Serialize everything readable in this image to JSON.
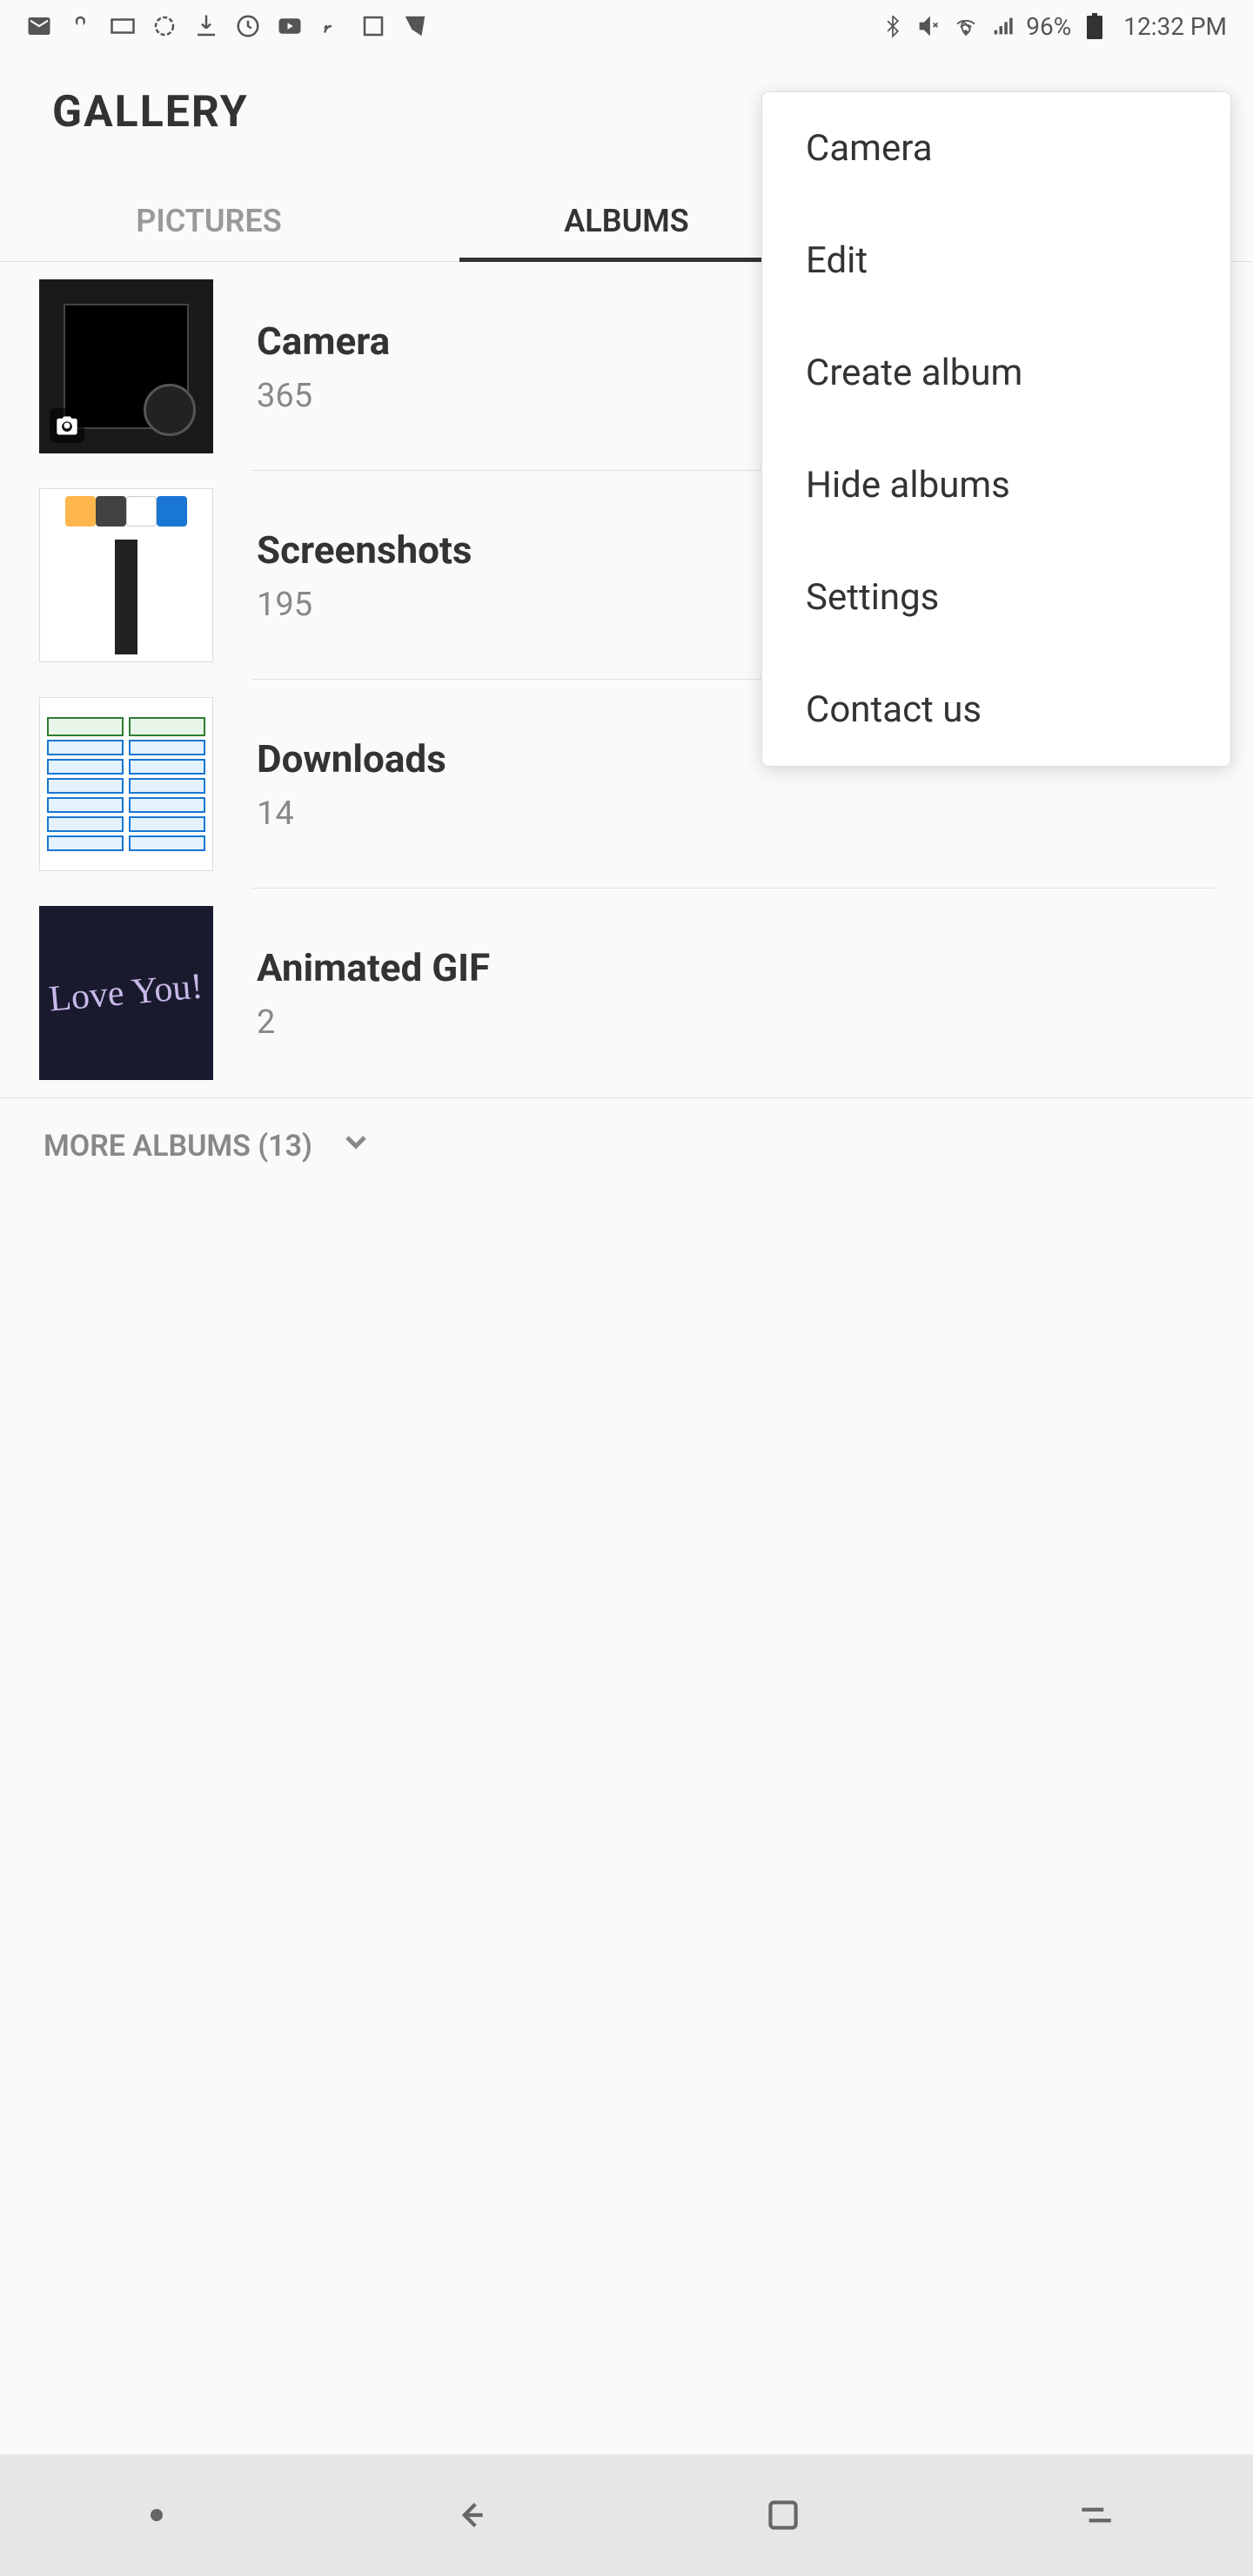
{
  "status_bar": {
    "battery": "96%",
    "time": "12:32 PM"
  },
  "app_title": "GALLERY",
  "tabs": {
    "pictures": "PICTURES",
    "albums": "ALBUMS",
    "active": "albums"
  },
  "albums": [
    {
      "name": "Camera",
      "count": "365",
      "thumb_type": "camera"
    },
    {
      "name": "Screenshots",
      "count": "195",
      "thumb_type": "screenshots"
    },
    {
      "name": "Downloads",
      "count": "14",
      "thumb_type": "downloads"
    },
    {
      "name": "Animated GIF",
      "count": "2",
      "thumb_type": "gif"
    }
  ],
  "more_albums_label": "MORE ALBUMS (13)",
  "menu": {
    "items": [
      "Camera",
      "Edit",
      "Create album",
      "Hide albums",
      "Settings",
      "Contact us"
    ]
  },
  "gif_text": "Love You!"
}
